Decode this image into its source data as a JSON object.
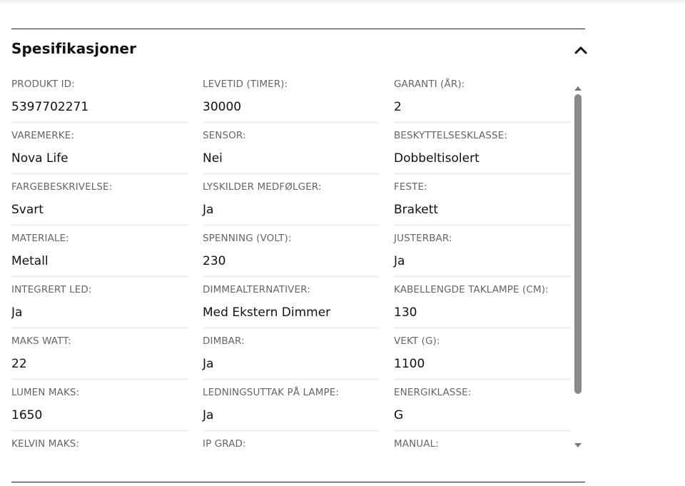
{
  "section": {
    "title": "Spesifikasjoner",
    "collapse_icon": "chevron-up-icon"
  },
  "specs": [
    {
      "label": "PRODUKT ID:",
      "value": "5397702271"
    },
    {
      "label": "LEVETID (TIMER):",
      "value": "30000"
    },
    {
      "label": "GARANTI (ÅR):",
      "value": "2"
    },
    {
      "label": "VAREMERKE:",
      "value": "Nova Life"
    },
    {
      "label": "SENSOR:",
      "value": "Nei"
    },
    {
      "label": "BESKYTTELSESKLASSE:",
      "value": "Dobbeltisolert"
    },
    {
      "label": "FARGEBESKRIVELSE:",
      "value": "Svart"
    },
    {
      "label": "LYSKILDER MEDFØLGER:",
      "value": "Ja"
    },
    {
      "label": "FESTE:",
      "value": "Brakett"
    },
    {
      "label": "MATERIALE:",
      "value": "Metall"
    },
    {
      "label": "SPENNING (VOLT):",
      "value": "230"
    },
    {
      "label": "JUSTERBAR:",
      "value": "Ja"
    },
    {
      "label": "INTEGRERT LED:",
      "value": "Ja"
    },
    {
      "label": "DIMMEALTERNATIVER:",
      "value": "Med Ekstern Dimmer"
    },
    {
      "label": "KABELLENGDE TAKLAMPE (CM):",
      "value": "130"
    },
    {
      "label": "MAKS WATT:",
      "value": "22"
    },
    {
      "label": "DIMBAR:",
      "value": "Ja"
    },
    {
      "label": "VEKT (G):",
      "value": "1100"
    },
    {
      "label": "LUMEN MAKS:",
      "value": "1650"
    },
    {
      "label": "LEDNINGSUTTAK PÅ LAMPE:",
      "value": "Ja"
    },
    {
      "label": "ENERGIKLASSE:",
      "value": "G"
    },
    {
      "label": "KELVIN MAKS:",
      "value": ""
    },
    {
      "label": "IP GRAD:",
      "value": ""
    },
    {
      "label": "MANUAL:",
      "value": ""
    }
  ],
  "colors": {
    "text": "#111111",
    "label": "#666666",
    "divider": "#e6e6e6",
    "scroll_thumb": "#8a8a8a"
  }
}
